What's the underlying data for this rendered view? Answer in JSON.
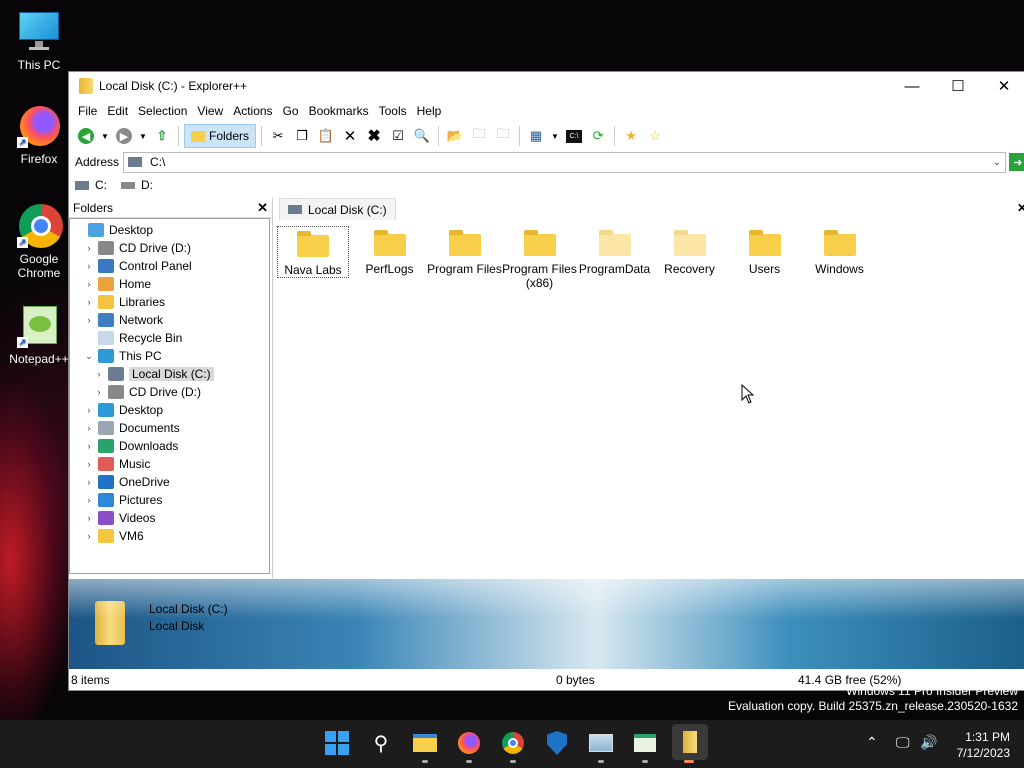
{
  "desktop": {
    "icons": [
      {
        "name": "desktop-icon-this-pc",
        "label": "This PC"
      },
      {
        "name": "desktop-icon-firefox",
        "label": "Firefox"
      },
      {
        "name": "desktop-icon-chrome",
        "label": "Google Chrome"
      },
      {
        "name": "desktop-icon-notepad",
        "label": "Notepad++"
      }
    ],
    "watermark_line1": "Windows 11 Pro Insider Preview",
    "watermark_line2": "Evaluation copy. Build 25375.zn_release.230520-1632"
  },
  "window": {
    "title": "Local Disk (C:) - Explorer++",
    "controls": {
      "minimize": "—",
      "maximize": "☐",
      "close": "✕"
    }
  },
  "menu": [
    "File",
    "Edit",
    "Selection",
    "View",
    "Actions",
    "Go",
    "Bookmarks",
    "Tools",
    "Help"
  ],
  "toolbar": {
    "folders_label": "Folders"
  },
  "address": {
    "label": "Address",
    "value": "C:\\"
  },
  "drives": [
    "C:",
    "D:"
  ],
  "folder_pane": {
    "header": "Folders",
    "close": "✕",
    "tree": [
      {
        "label": "Desktop",
        "level": 0,
        "expander": "",
        "icon": "desktop-icon",
        "color": "#4aa3df"
      },
      {
        "label": "CD Drive (D:)",
        "level": 1,
        "expander": "›",
        "icon": "cd-drive-icon",
        "color": "#888888"
      },
      {
        "label": "Control Panel",
        "level": 1,
        "expander": "›",
        "icon": "control-panel-icon",
        "color": "#3b78c2"
      },
      {
        "label": "Home",
        "level": 1,
        "expander": "›",
        "icon": "home-icon",
        "color": "#e8a33c"
      },
      {
        "label": "Libraries",
        "level": 1,
        "expander": "›",
        "icon": "libraries-icon",
        "color": "#f5c542"
      },
      {
        "label": "Network",
        "level": 1,
        "expander": "›",
        "icon": "network-icon",
        "color": "#3f7fbf"
      },
      {
        "label": "Recycle Bin",
        "level": 1,
        "expander": "",
        "icon": "recycle-bin-icon",
        "color": "#c8d8e8"
      },
      {
        "label": "This PC",
        "level": 1,
        "expander": "⌄",
        "icon": "this-pc-icon",
        "color": "#2d9ad8"
      },
      {
        "label": "Local Disk (C:)",
        "level": 2,
        "expander": "›",
        "icon": "local-disk-icon",
        "color": "#6a7c8e",
        "selected": true
      },
      {
        "label": "CD Drive (D:)",
        "level": 2,
        "expander": "›",
        "icon": "cd-drive-icon",
        "color": "#888888"
      },
      {
        "label": "Desktop",
        "level": 1,
        "expander": "›",
        "icon": "desktop-icon",
        "color": "#2d9ad8"
      },
      {
        "label": "Documents",
        "level": 1,
        "expander": "›",
        "icon": "documents-icon",
        "color": "#9aa6b2"
      },
      {
        "label": "Downloads",
        "level": 1,
        "expander": "›",
        "icon": "downloads-icon",
        "color": "#2aa36a"
      },
      {
        "label": "Music",
        "level": 1,
        "expander": "›",
        "icon": "music-icon",
        "color": "#e05a5a"
      },
      {
        "label": "OneDrive",
        "level": 1,
        "expander": "›",
        "icon": "onedrive-icon",
        "color": "#1e73c8"
      },
      {
        "label": "Pictures",
        "level": 1,
        "expander": "›",
        "icon": "pictures-icon",
        "color": "#2d8ad8"
      },
      {
        "label": "Videos",
        "level": 1,
        "expander": "›",
        "icon": "videos-icon",
        "color": "#8a4fc8"
      },
      {
        "label": "VM6",
        "level": 1,
        "expander": "›",
        "icon": "folder-icon",
        "color": "#f5c542"
      }
    ]
  },
  "tab": {
    "label": "Local Disk (C:)",
    "close": "✕"
  },
  "files": [
    {
      "name": "Nava Labs",
      "faded": false,
      "focused": true
    },
    {
      "name": "PerfLogs",
      "faded": false
    },
    {
      "name": "Program Files",
      "faded": false
    },
    {
      "name": "Program Files (x86)",
      "faded": false
    },
    {
      "name": "ProgramData",
      "faded": true
    },
    {
      "name": "Recovery",
      "faded": true
    },
    {
      "name": "Users",
      "faded": false
    },
    {
      "name": "Windows",
      "faded": false
    }
  ],
  "display_window": {
    "line1": "Local Disk (C:)",
    "line2": "Local Disk"
  },
  "status": {
    "items": "8 items",
    "size": "0 bytes",
    "free": "41.4 GB free (52%)"
  },
  "taskbar": {
    "time": "1:31 PM",
    "date": "7/12/2023"
  }
}
